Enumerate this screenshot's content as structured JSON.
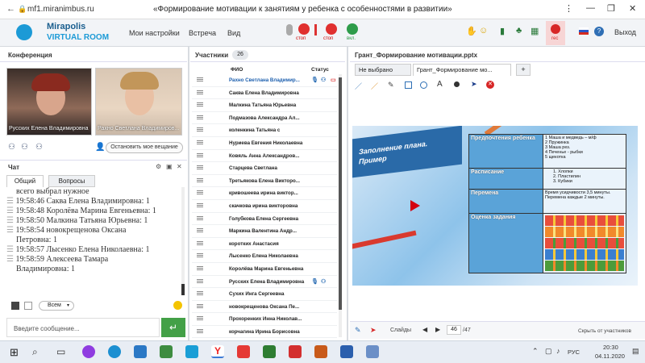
{
  "browser": {
    "url": "mf1.miranimbus.ru",
    "page_title": "«Формирование мотивации к занятиям у ребенка с особенностями в развитии»"
  },
  "app": {
    "logo_line1": "Mirapolis",
    "logo_line2": "VIRTUAL ROOM",
    "menu": [
      "Мои настройки",
      "Встреча",
      "Вид"
    ],
    "mic_label": "стоп",
    "cam_label": "стоп",
    "share_label": "вкл.",
    "rec_label": "rec",
    "exit_label": "Выход"
  },
  "conference": {
    "title": "Конференция",
    "video1_name": "Русских Елена Владимировна",
    "video2_name": "Рахно Светлана Владимиров...",
    "stop_broadcast": "Остановить мое вещание"
  },
  "chat": {
    "title": "Чат",
    "tabs": [
      "Общий",
      "Вопросы"
    ],
    "messages": [
      "всего выбрал нужное",
      "19:58:46 Саква Елена Владимировна: 1",
      "19:58:48 Королёва Марина Евгеньевна: 1",
      "19:58:50 Малкина Татьяна Юрьевна: 1",
      "19:58:54 новокрещенова Оксана",
      "Петровна: 1",
      "19:58:57 Лысенко Елена Николаевна: 1",
      "19:58:59 Алексеева Тамара",
      "Владимировна: 1"
    ],
    "audience": "Всем",
    "input_placeholder": "Введите сообщение..."
  },
  "participants": {
    "title": "Участники",
    "count": "26",
    "col_name": "ФИО",
    "col_status": "Статус",
    "names": [
      "Рахно Светлана Владимир...",
      "Саква Елена Владимировна",
      "Малкина Татьяна Юрьевна",
      "Подмазова Александра Ал...",
      "коленкина Татьяна с",
      "Нуриева Евгения Николаевна",
      "Ковяль Анна Александров...",
      "Старцева Светлана",
      "Третьякова Елена Викторо...",
      "кривошеева ирина виктор...",
      "скачкова ирина викторовна",
      "Голубкова Елена Сергеевна",
      "Маркина Валентина Андр...",
      "коротких Анастасия",
      "Лысенко Елена Николаевна",
      "Королёва Марина Евгеньевна",
      "Русских Елена Владимировна",
      "Сухих Инга Сергеевна",
      "новокрещенова Оксана Пе...",
      "Прохоренких Инна Николав...",
      "корчагина Ирина Борисовна"
    ]
  },
  "presentation": {
    "file_title": "Грант_Формирование мотивации.pptx",
    "tabs": [
      "Не выбрано",
      "Грант_Формирование мо..."
    ],
    "tab_add": "+",
    "slide_title_line1": "Заполнение плана.",
    "slide_title_line2": "Пример",
    "table": [
      {
        "label": "Предпочтения ребенка",
        "content": [
          "1 Маша и медведь – м/ф",
          "2 Пружинка",
          "3 Маша рез.",
          "4 Печенье - рыбки",
          "5 щекотка"
        ]
      },
      {
        "label": "Расписание",
        "content": [
          "1. Хлопки",
          "2. Пластилин",
          "3. Кубики"
        ]
      },
      {
        "label": "Перемена",
        "content": [
          "Время усидчивости 3,5 минуты.",
          "Перемена каждые 2 минуты."
        ]
      },
      {
        "label": "Оценка задания",
        "content": []
      }
    ],
    "slides_label": "Слайды",
    "current_slide": "46",
    "total_slides": "/47",
    "hide_label": "Скрыть от участников"
  },
  "taskbar": {
    "lang": "РУС",
    "time": "20:30",
    "date": "04.11.2020"
  }
}
